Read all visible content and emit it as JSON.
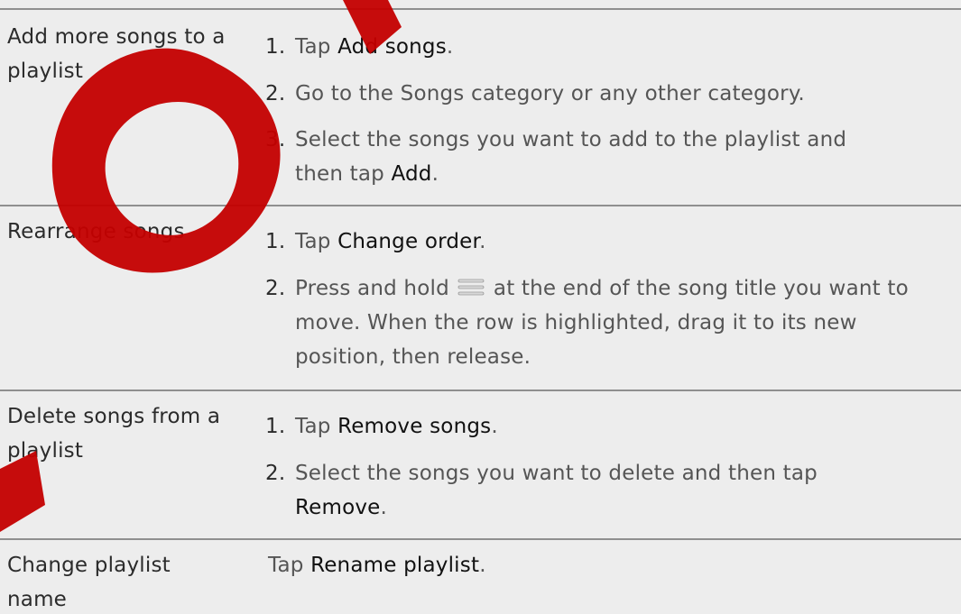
{
  "rows": [
    {
      "label": "Add more songs to a playlist",
      "steps": [
        {
          "num": "1.",
          "pre": "Tap ",
          "action": "Add songs",
          "post": "."
        },
        {
          "num": "2.",
          "pre": "Go to the Songs category or any other category.",
          "action": "",
          "post": ""
        },
        {
          "num": "3.",
          "pre": "Select the songs you want to add to the playlist and then tap ",
          "action": "Add",
          "post": "."
        }
      ]
    },
    {
      "label": "Rearrange songs",
      "steps": [
        {
          "num": "1.",
          "pre": "Tap ",
          "action": "Change order",
          "post": "."
        },
        {
          "num": "2.",
          "pre": "Press and hold",
          "action": "",
          "post": "at the end of the song title you want to move. When the row is highlighted, drag it to its new position, then release."
        }
      ]
    },
    {
      "label": "Delete songs from a playlist",
      "steps": [
        {
          "num": "1.",
          "pre": "Tap ",
          "action": "Remove songs",
          "post": "."
        },
        {
          "num": "2.",
          "pre": "Select the songs you want to delete and then tap ",
          "action": "Remove",
          "post": "."
        }
      ]
    },
    {
      "label": "Change playlist name",
      "text": {
        "pre": "Tap ",
        "action": "Rename playlist",
        "post": "."
      }
    }
  ],
  "icons": {
    "drag_handle": "drag-handle-icon"
  },
  "colors": {
    "background": "#ededed",
    "divider": "#8f8f8f",
    "text": "#2b2b2b",
    "watermark": "#c40000"
  }
}
